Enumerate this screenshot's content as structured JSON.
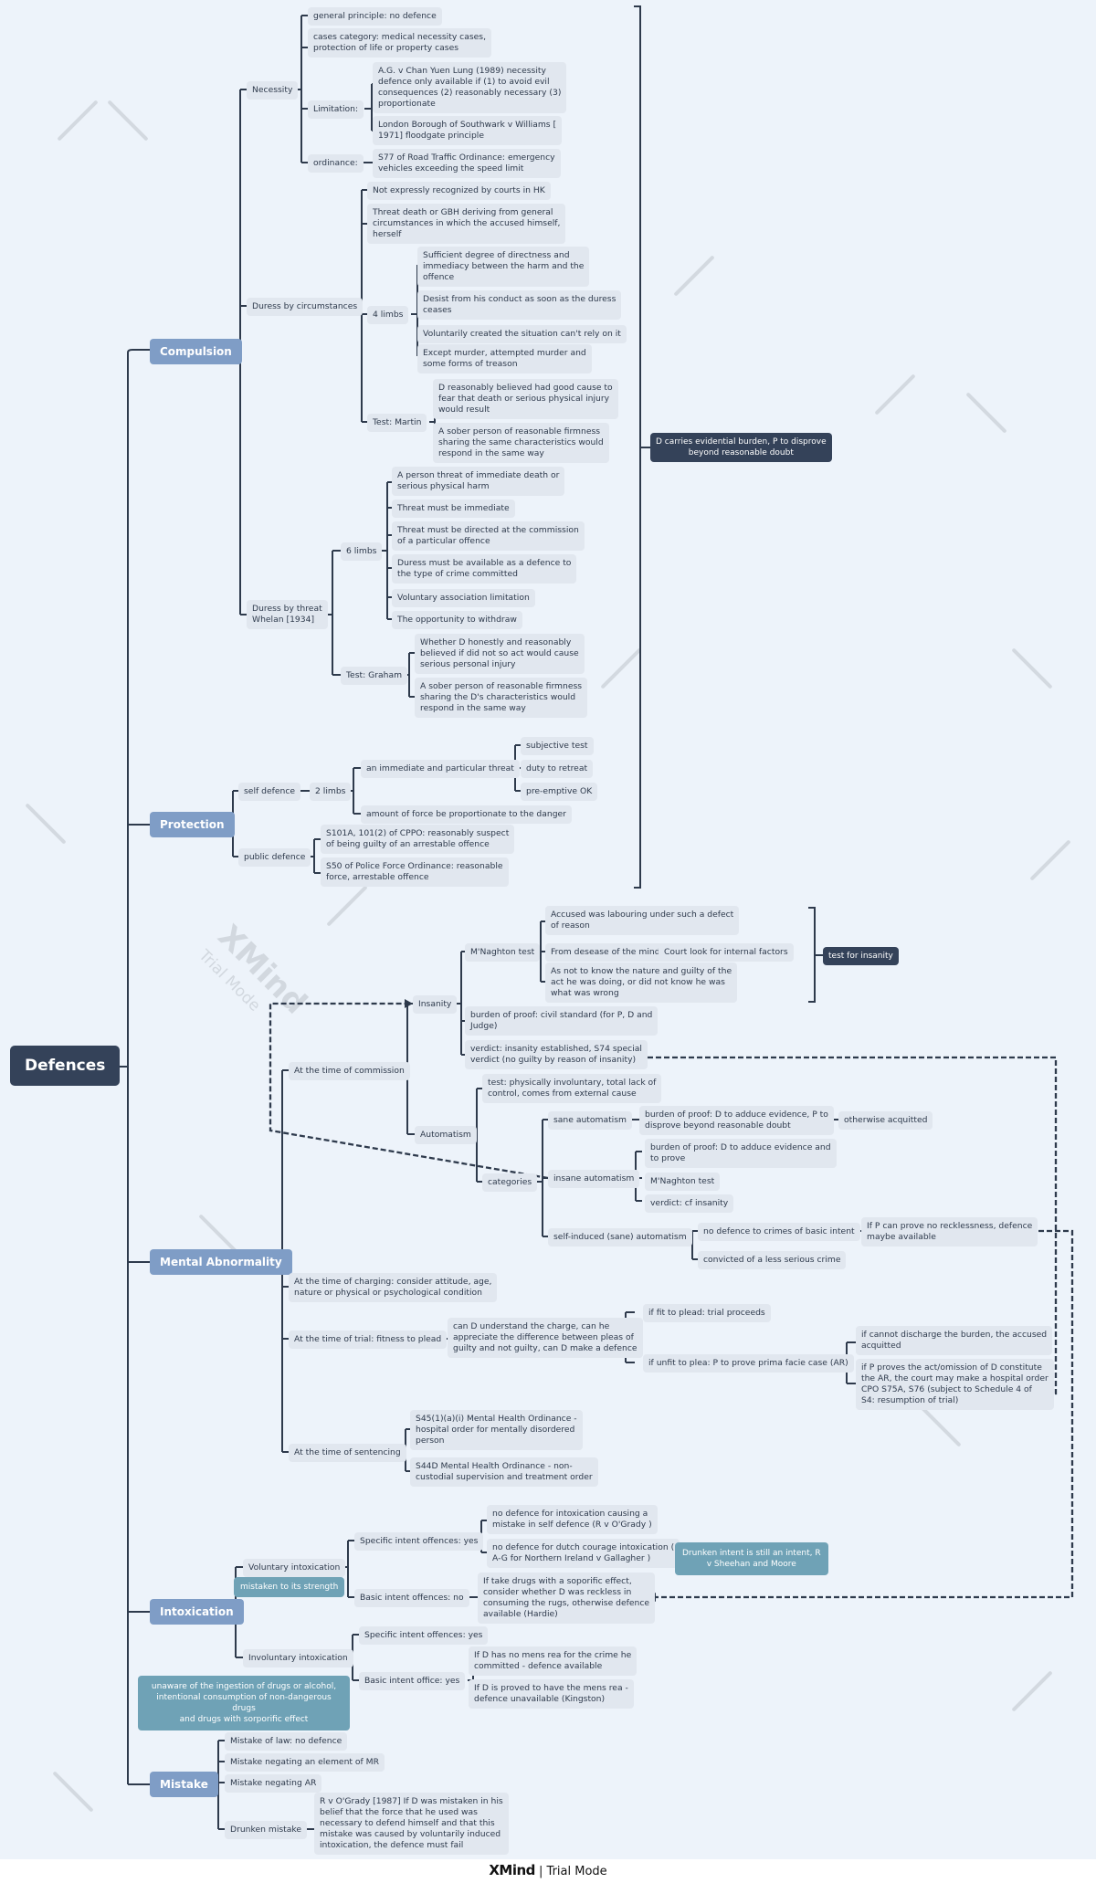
{
  "root": "Defences",
  "colors": {
    "background": "#edf3fa",
    "root": "#344259",
    "main_topic": "#7f9dc6",
    "subtopic": "#e1e7ef",
    "line": "#2e3a4c",
    "callout": "#6fa2b6",
    "summary": "#344259"
  },
  "compulsion": {
    "label": "Compulsion",
    "necessity": {
      "label": "Necessity",
      "general": "general principle: no defence",
      "cases": "cases category: medical necessity cases,\nprotection of life or property cases",
      "limitation": "Limitation:",
      "lim1": " A.G. v Chan Yuen Lung (1989) necessity\ndefence only available if (1) to avoid evil\nconsequences (2) reasonably necessary (3)\nproportionate",
      "lim2": "London Borough of Southwark v Williams [\n1971] floodgate principle",
      "ordinance": "ordinance:",
      "ord1": " S77 of Road Traffic Ordinance: emergency\nvehicles exceeding the speed limit"
    },
    "circ": {
      "label": "Duress by circumstances",
      "c1": "Not expressly recognized by courts in HK",
      "c2": "Threat death or GBH deriving from general\ncircumstances in which the accused himself,\nherself",
      "limbs": "4 limbs",
      "l1": "Sufficient degree of directness and\nimmediacy between the harm and the\noffence",
      "l2": "Desist from his conduct as soon as the duress\nceases",
      "l3": "Voluntarily created the situation can't rely on it",
      "l4": "Except murder, attempted murder and\nsome forms of treason",
      "test": "Test: Martin",
      "t1": "D reasonably believed had good cause to\nfear that death or serious physical injury\nwould result",
      "t2": "A sober person of reasonable firmness\nsharing the same characteristics would\nrespond in the same way"
    },
    "threat": {
      "label": "Duress by threat\nWhelan [1934]",
      "limbs": "6 limbs",
      "l1": "A person threat of immediate death or\nserious physical harm",
      "l2": "Threat must be immediate",
      "l3": "Threat must be directed at the commission\nof a particular offence",
      "l4": "Duress must be available as a defence to\nthe type of crime committed",
      "l5": "Voluntary association limitation",
      "l6": "The opportunity to withdraw",
      "test": "Test: Graham",
      "t1": "Whether D honestly and reasonably\nbelieved if did not so act would cause\nserious personal injury",
      "t2": "A sober person of reasonable firmness\nsharing the D's characteristics would\nrespond in the same way"
    }
  },
  "protection": {
    "label": "Protection",
    "self": "self defence",
    "limbs": "2 limbs",
    "threat": "an immediate and particular threat",
    "subj": "subjective test",
    "duty": "duty to retreat",
    "pre": "pre-emptive OK",
    "force": "amount of force be proportionate to the danger",
    "public": "public defence",
    "p1": "S101A, 101(2) of CPPO: reasonably suspect\nof being guilty of an arrestable offence",
    "p2": "S50 of Police Force Ordinance: reasonable\nforce, arrestable offence"
  },
  "summary_burden": "D carries evidential burden, P to disprove\nbeyond reasonable doubt",
  "mental": {
    "label": "Mental Abnormality",
    "commission": "At the time of commission",
    "insanity": "Insanity",
    "mnaghten": "M'Naghton test",
    "m1": "Accused was labouring under such a defect\nof reason",
    "m2": "From desease of the mind",
    "m2a": "Court look for internal factors",
    "m3": "As not to know the nature and guilty of the\nact he was doing, or did not know he was\nwhat was wrong",
    "summary_insanity": "test for insanity",
    "ins_burden": "burden of proof: civil standard (for P, D and\nJudge)",
    "ins_verdict": "verdict: insanity established, S74 special\nverdict (no guilty by reason of insanity)",
    "automatism": "Automatism",
    "auto_test": "test: physically involuntary, total lack of\ncontrol, comes from external cause",
    "categories": "categories",
    "sane": "sane automatism",
    "sane_burden": "burden of proof: D to adduce evidence, P to\ndisprove beyond reasonable doubt",
    "sane_result": "otherwise acquitted",
    "insane": "insane automatism",
    "insane_burden": "burden of proof: D to adduce evidence and\nto prove",
    "insane_test": "M'Naghton test",
    "insane_verdict": "verdict: cf insanity",
    "self_induced": "self-induced (sane) automatism",
    "si1": "no defence to crimes of basic intent",
    "si1a": "If P can prove no recklessness, defence\nmaybe available",
    "si2": "convicted of a less serious crime",
    "charging": "At the time of charging: consider attitude, age,\nnature or physical or psychological condition",
    "trial": "At the time of trial: fitness to plead",
    "trial_q": "can D understand the charge, can he\nappreciate the difference between pleas of\nguilty and not guilty, can D make a defence",
    "fit": "if fit to plead: trial proceeds",
    "unfit": "if unfit to plea: P to prove prima facie case (AR)",
    "unfit1": "if cannot discharge the burden, the accused\nacquitted",
    "unfit2": "if P proves the act/omission of D constitute\nthe AR, the court may make a hospital order\nCPO S75A, S76 (subject to Schedule 4 of\nS4: resumption of trial)",
    "sentencing": "At the time of sentencing",
    "s1": "S45(1)(a)(i) Mental Health Ordinance -\nhospital order for mentally disordered\nperson",
    "s2": "S44D Mental Health Ordinance - non-\ncustodial supervision and treatment order"
  },
  "intoxication": {
    "label": "Intoxication",
    "voluntary": "Voluntary intoxication",
    "callout_strength": "mistaken to its strength",
    "spec": "Specific intent offences: yes",
    "spec1": "no defence for intoxication causing a\nmistake in self defence (R v O'Grady )",
    "spec2": "no defence for dutch courage intoxication  (\nA-G for Northern Ireland v Gallagher )",
    "callout_drunken": "Drunken intent is still an intent, R\nv Sheehan and Moore",
    "basic": "Basic intent offences: no",
    "basic1": "If take drugs with a soporific effect,\nconsider whether D was reckless in\nconsuming the rugs, otherwise defence\navailable (Hardie)",
    "involuntary": "Involuntary intoxication",
    "callout_unaware": "unaware of the ingestion of drugs or alcohol,\nintentional consumption of non-dangerous drugs\nand drugs with sorporific effect",
    "inv_spec": "Specific intent offences: yes",
    "inv_basic": "Basic intent office: yes",
    "ib1": "If D has no mens rea for the crime he\ncommitted - defence available",
    "ib2": "If D is proved to have the mens rea -\ndefence unavailable (Kingston)"
  },
  "mistake": {
    "label": "Mistake",
    "law": "Mistake of law: no defence",
    "mr": "Mistake negating an element of MR",
    "ar": "Mistake negating AR",
    "drunken": "Drunken mistake",
    "ogrady": "R v  O'Grady [1987] If D was mistaken in his\nbelief that the force that he used was\nnecessary to defend himself and that this\nmistake was caused by voluntarily induced\nintoxication, the defence must fail"
  },
  "watermark": {
    "brand": "XMind",
    "mode": "Trial Mode"
  },
  "footer": {
    "brand": "XMind",
    "mode": "Trial Mode"
  }
}
